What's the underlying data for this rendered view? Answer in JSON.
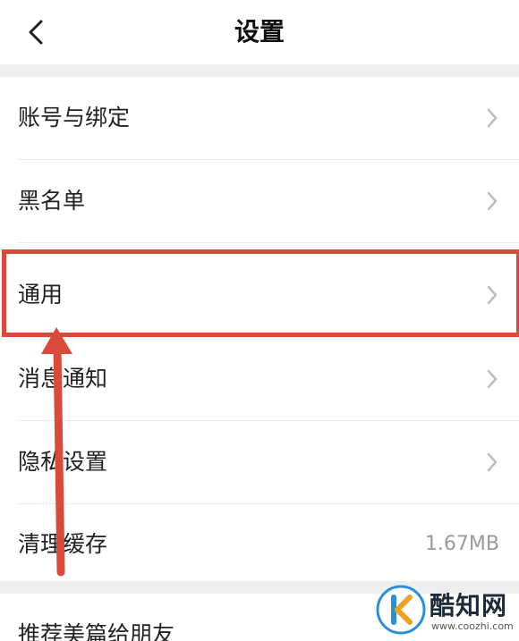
{
  "header": {
    "title": "设置",
    "back_icon": "chevron-left-icon"
  },
  "settings": {
    "items": [
      {
        "label": "账号与绑定",
        "icon": "chevron-right-icon"
      },
      {
        "label": "黑名单",
        "icon": "chevron-right-icon"
      },
      {
        "label": "通用",
        "icon": "chevron-right-icon",
        "highlighted": true
      },
      {
        "label": "消息通知",
        "icon": "chevron-right-icon"
      },
      {
        "label": "隐私设置",
        "icon": "chevron-right-icon"
      },
      {
        "label": "清理缓存",
        "value": "1.67MB"
      }
    ],
    "partial_item": {
      "label": "推荐美篇给朋友"
    }
  },
  "annotation": {
    "highlight_color": "#d94a3b"
  },
  "watermark": {
    "brand": "酷知网",
    "url": "www.coozhi.com"
  }
}
